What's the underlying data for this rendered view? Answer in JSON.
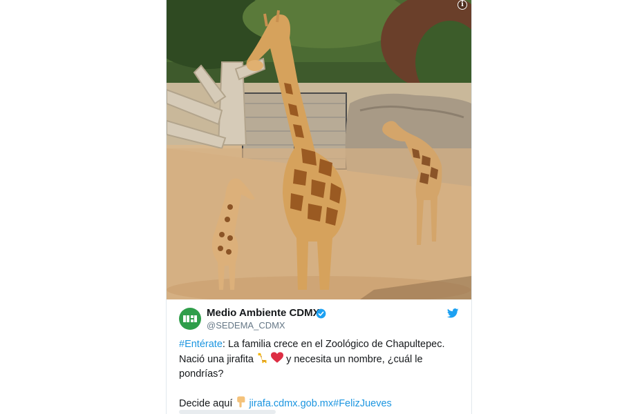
{
  "tweet": {
    "author_name": "Medio Ambiente CDMX",
    "author_handle": "@SEDEMA_CDMX",
    "hashtag_enterate": "#Entérate",
    "line1_rest": ": La familia crece en el Zoológico de Chapultepec.",
    "line2_start": "Nació una jirafita",
    "line2_end": "y necesita un nombre, ¿cuál le",
    "line3": "pondrías?",
    "line4_start": "Decide aquí",
    "link_url": "jirafa.cdmx.gob.mx",
    "hashtag_feliz": "#FelizJueves"
  },
  "icons": {
    "info": "info-icon",
    "verified": "verified-badge-icon",
    "twitter": "twitter-bird-icon",
    "emoji_giraffe": "giraffe-emoji",
    "emoji_heart": "red-heart-emoji",
    "emoji_pointing": "backhand-index-pointing-down-emoji"
  },
  "colors": {
    "link": "#1b95e0",
    "avatar": "#2f9e4a",
    "verified": "#1da1f2",
    "text": "#14171a",
    "muted": "#657786"
  }
}
